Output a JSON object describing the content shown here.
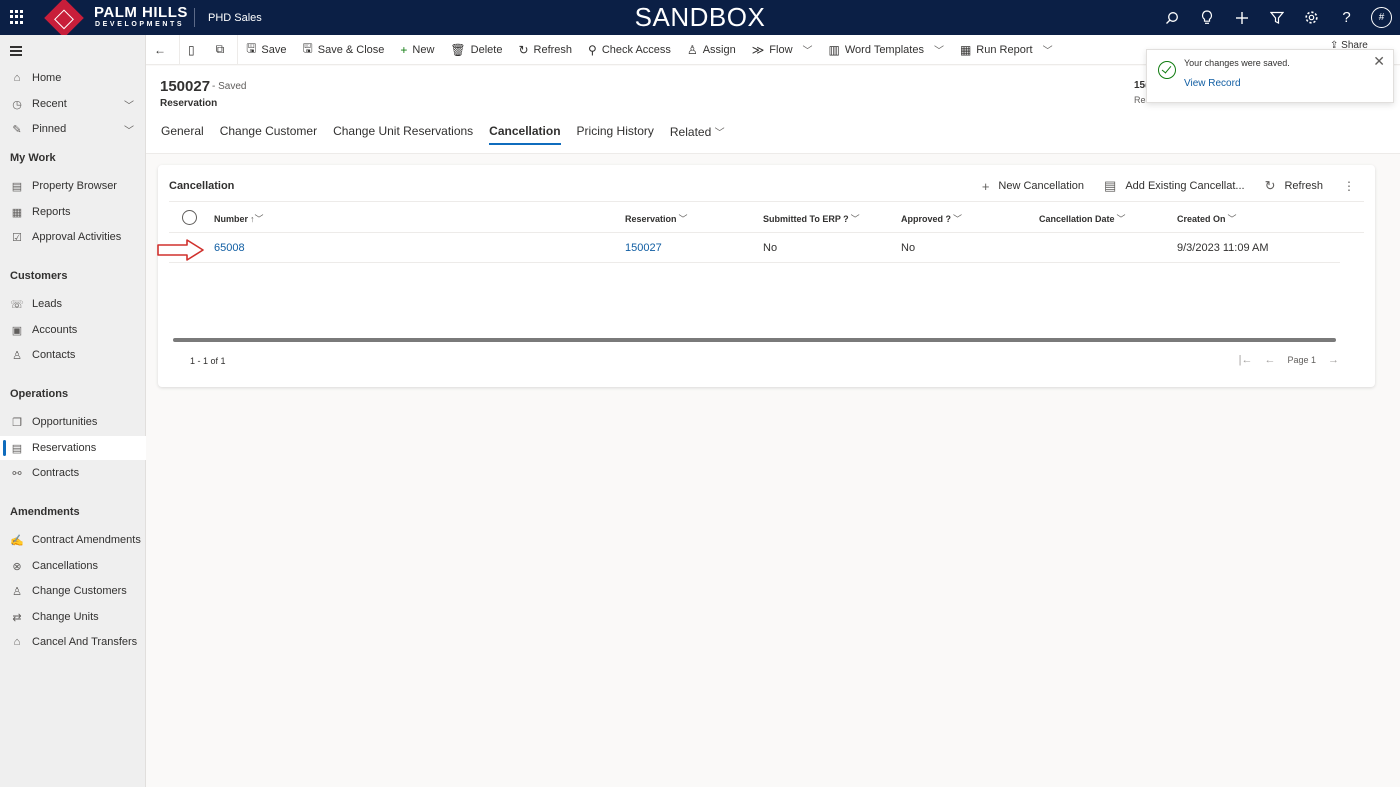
{
  "topbar": {
    "logo_text": "PALM HILLS",
    "logo_sub": "DEVELOPMENTS",
    "app_name": "PHD Sales",
    "environment": "SANDBOX",
    "avatar_initial": "#",
    "icons": [
      "search-icon",
      "lightbulb-icon",
      "plus-icon",
      "filter-icon",
      "gear-icon",
      "help-icon"
    ]
  },
  "sidebar": {
    "items_top": [
      {
        "label": "Home",
        "icon": "home-icon"
      },
      {
        "label": "Recent",
        "icon": "clock-icon"
      },
      {
        "label": "Pinned",
        "icon": "pin-icon"
      }
    ],
    "groups": {
      "my_work": "My Work",
      "customers": "Customers",
      "operations": "Operations",
      "amendments": "Amendments"
    },
    "my_work": [
      "Property Browser",
      "Reports",
      "Approval Activities"
    ],
    "customers": [
      "Leads",
      "Accounts",
      "Contacts"
    ],
    "operations": [
      "Opportunities",
      "Reservations",
      "Contracts"
    ],
    "amendments": [
      "Contract Amendments",
      "Cancellations",
      "Change Customers",
      "Change Units",
      "Cancel And Transfers"
    ],
    "active": "Reservations"
  },
  "commands": {
    "save": "Save",
    "save_close": "Save & Close",
    "new": "New",
    "delete": "Delete",
    "refresh": "Refresh",
    "check_access": "Check Access",
    "assign": "Assign",
    "flow": "Flow",
    "word_templates": "Word Templates",
    "run_report": "Run Report",
    "share": "Share"
  },
  "record": {
    "title": "150027",
    "saved": "- Saved",
    "entity": "Reservation",
    "header_right_a": "15(",
    "header_right_b": "Res"
  },
  "tabs": [
    "General",
    "Change Customer",
    "Change Unit Reservations",
    "Cancellation",
    "Pricing History",
    "Related"
  ],
  "active_tab": "Cancellation",
  "grid": {
    "title": "Cancellation",
    "cmd_new": "New Cancellation",
    "cmd_add_existing": "Add Existing Cancellat...",
    "cmd_refresh": "Refresh",
    "columns": [
      "Number",
      "Reservation",
      "Submitted To ERP ?",
      "Approved ?",
      "Cancellation Date",
      "Created On"
    ],
    "rows": [
      {
        "number": "65008",
        "reservation": "150027",
        "submitted": "No",
        "approved": "No",
        "cancellation_date": "",
        "created_on": "9/3/2023 11:09 AM"
      }
    ],
    "pager_count": "1 - 1 of 1",
    "pager_page": "Page 1"
  },
  "toast": {
    "message": "Your changes were saved.",
    "link": "View Record"
  },
  "colors": {
    "topbar": "#0b1f45",
    "accent": "#0f6cbd",
    "link": "#115ea3",
    "arrow": "#d0312d",
    "success": "#107c10"
  }
}
